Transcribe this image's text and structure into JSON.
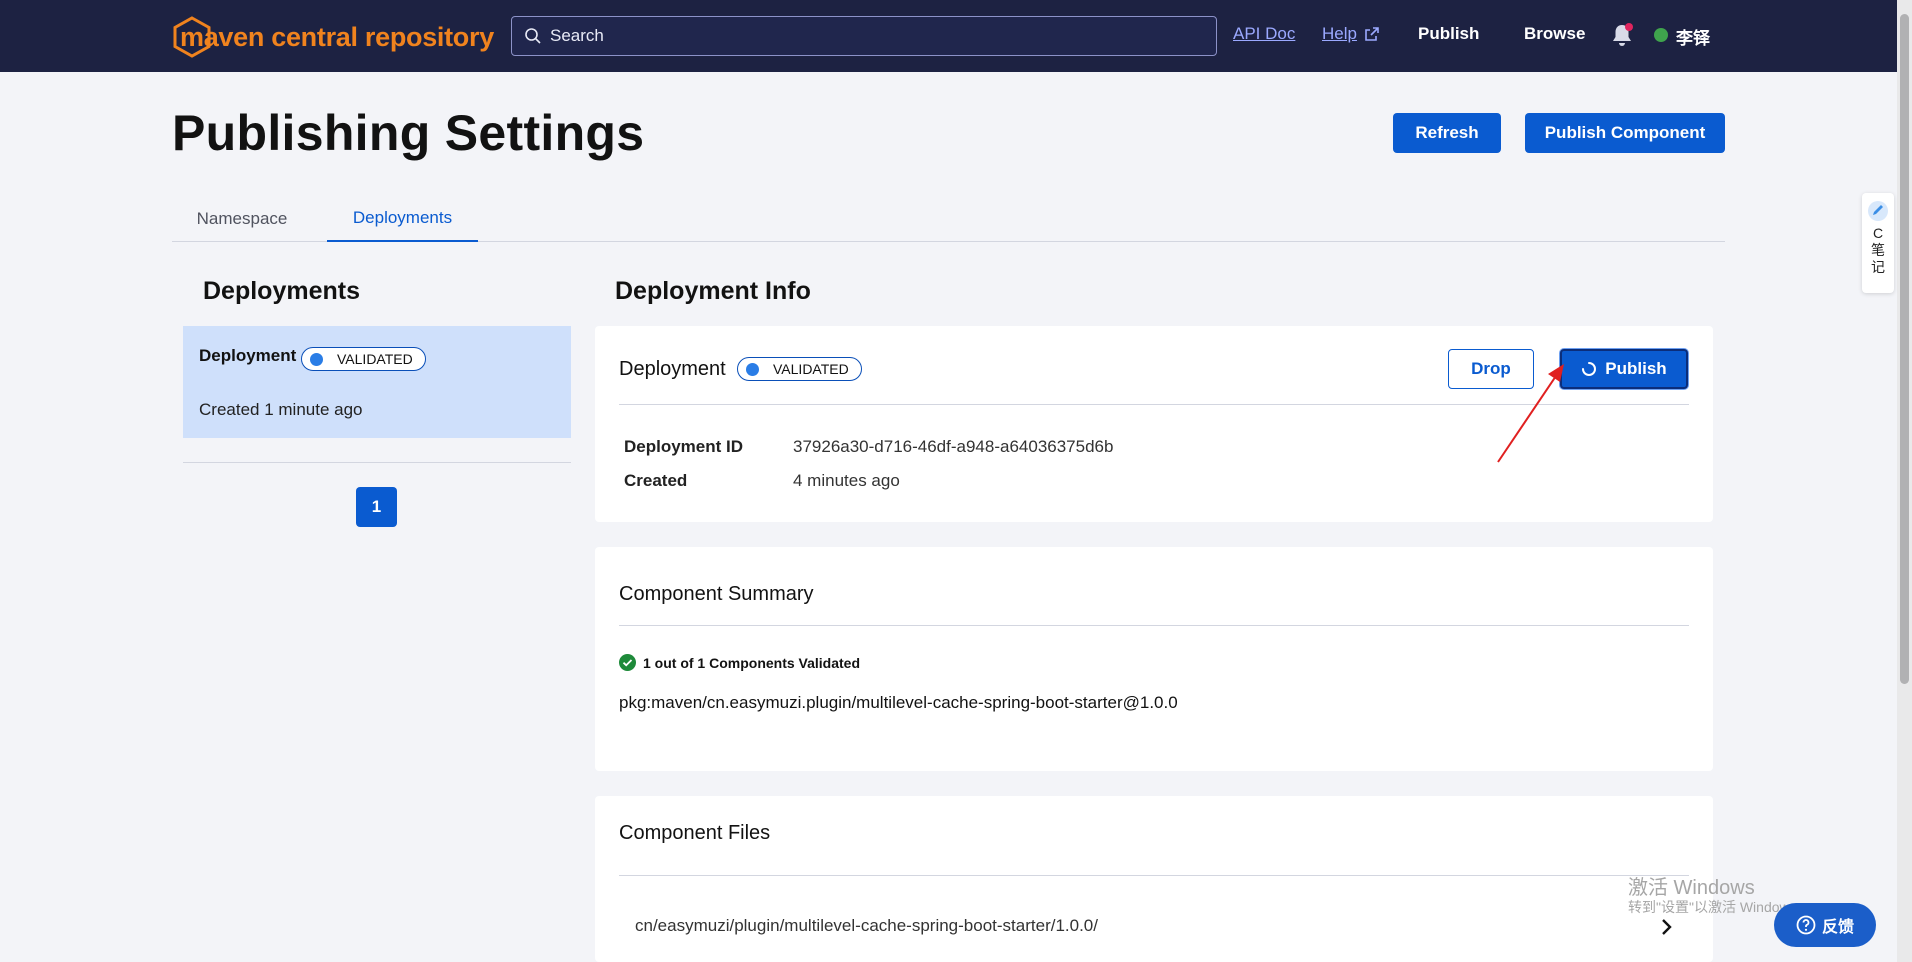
{
  "header": {
    "logo_text": "maven central repository",
    "search_placeholder": "Search",
    "nav": {
      "api_doc": "API Doc",
      "help": "Help",
      "publish": "Publish",
      "browse": "Browse"
    },
    "user_name": "李铎"
  },
  "page": {
    "title": "Publishing Settings",
    "refresh_label": "Refresh",
    "publish_component_label": "Publish Component"
  },
  "tabs": [
    {
      "label": "Namespace"
    },
    {
      "label": "Deployments"
    }
  ],
  "deployments_panel": {
    "heading": "Deployments",
    "items": [
      {
        "title": "Deployment",
        "status": "VALIDATED",
        "created": "Created 1 minute ago"
      }
    ],
    "pages": [
      "1"
    ]
  },
  "deployment_info": {
    "heading": "Deployment Info",
    "title": "Deployment",
    "status": "VALIDATED",
    "drop_label": "Drop",
    "publish_label": "Publish",
    "id_label": "Deployment ID",
    "id_value": "37926a30-d716-46df-a948-a64036375d6b",
    "created_label": "Created",
    "created_value": "4 minutes ago"
  },
  "component_summary": {
    "title": "Component Summary",
    "validated_text": "1 out of 1 Components Validated",
    "purl": "pkg:maven/cn.easymuzi.plugin/multilevel-cache-spring-boot-starter@1.0.0"
  },
  "component_files": {
    "title": "Component Files",
    "path": "cn/easymuzi/plugin/multilevel-cache-spring-boot-starter/1.0.0/"
  },
  "side_widget": {
    "text": "C笔记"
  },
  "watermark": {
    "line1": "激活 Windows",
    "line2": "转到\"设置\"以激活 Windows。"
  },
  "feedback_label": "反馈",
  "colors": {
    "header_bg": "#1d2242",
    "brand_orange": "#f0831e",
    "primary_blue": "#0a5bd0",
    "selected_bg": "#cfe0fb",
    "success_green": "#1e8a3a"
  }
}
